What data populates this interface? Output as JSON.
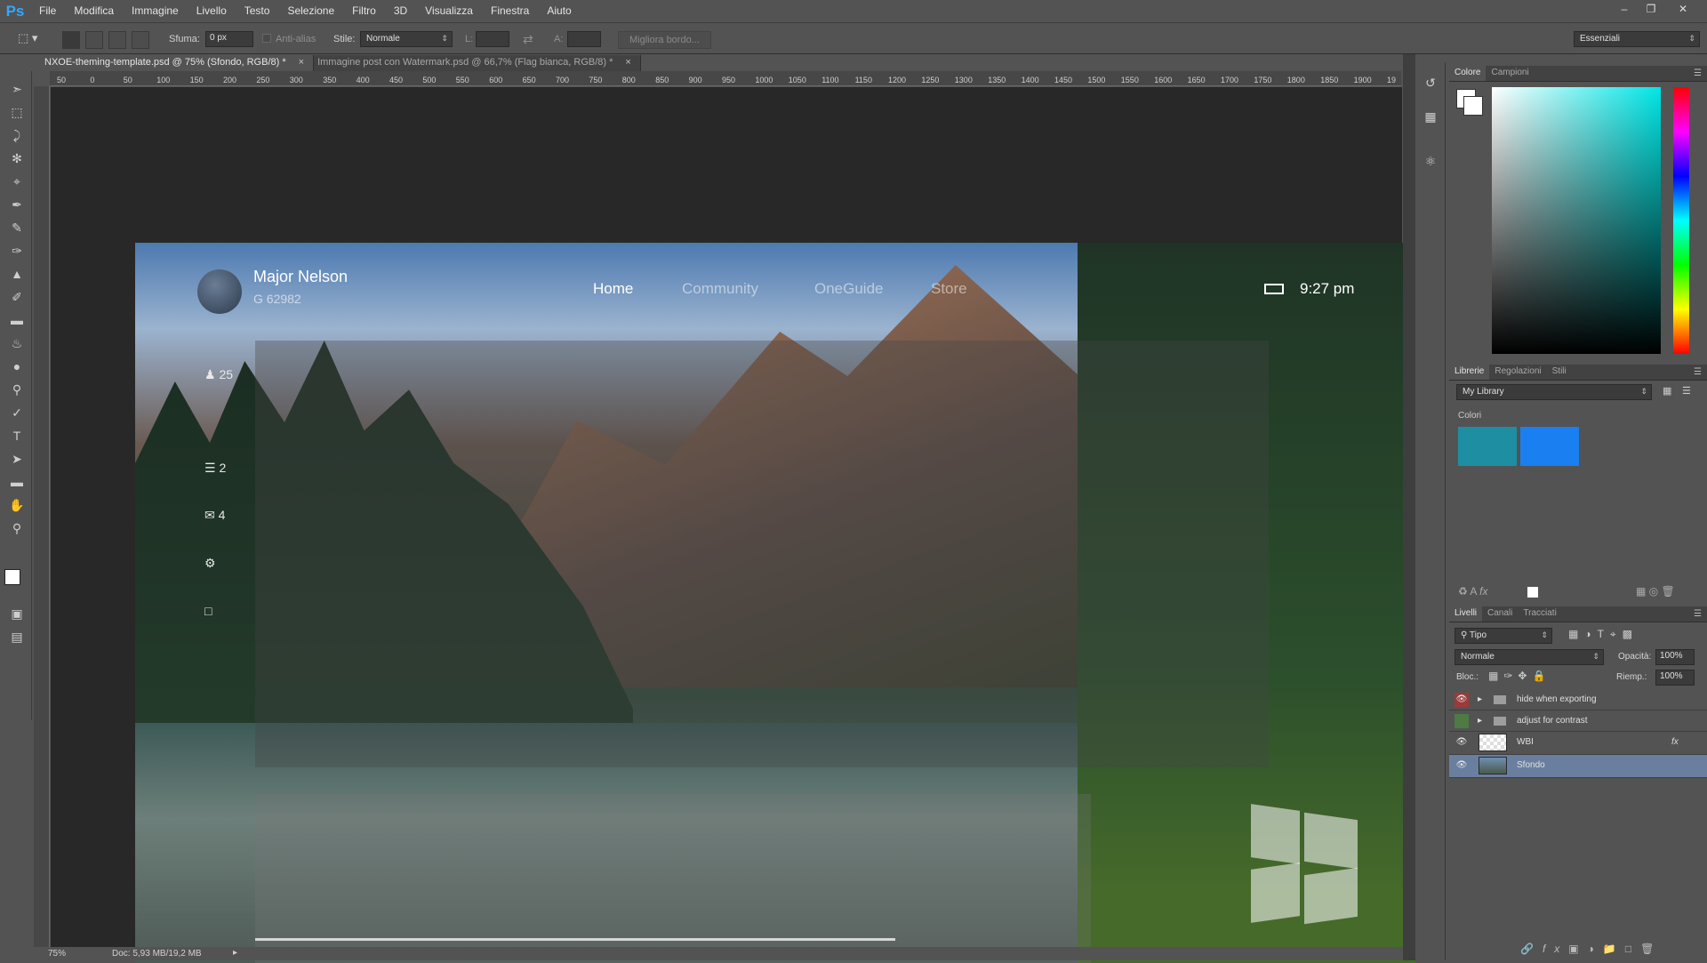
{
  "menu": {
    "logo": "Ps",
    "items": [
      "File",
      "Modifica",
      "Immagine",
      "Livello",
      "Testo",
      "Selezione",
      "Filtro",
      "3D",
      "Visualizza",
      "Finestra",
      "Aiuto"
    ]
  },
  "options": {
    "feather_label": "Sfuma:",
    "feather_value": "0 px",
    "antialias_label": "Anti-alias",
    "style_label": "Stile:",
    "style_value": "Normale",
    "width_label": "L:",
    "height_label": "A:",
    "refine_button": "Migliora bordo...",
    "workspace": "Essenziali"
  },
  "tabs": [
    {
      "label": "NXOE-theming-template.psd @ 75% (Sfondo, RGB/8) *",
      "close": "×"
    },
    {
      "label": "Immagine post con Watermark.psd @ 66,7% (Flag bianca, RGB/8) *",
      "close": "×"
    }
  ],
  "ruler_ticks": [
    "50",
    "0",
    "50",
    "100",
    "150",
    "200",
    "250",
    "300",
    "350",
    "400",
    "450",
    "500",
    "550",
    "600",
    "650",
    "700",
    "750",
    "800",
    "850",
    "900",
    "950",
    "1000",
    "1050",
    "1100",
    "1150",
    "1200",
    "1250",
    "1300",
    "1350",
    "1400",
    "1450",
    "1500",
    "1550",
    "1600",
    "1650",
    "1700",
    "1750",
    "1800",
    "1850",
    "1900",
    "19"
  ],
  "artwork": {
    "user_name": "Major Nelson",
    "gamerscore": "G 62982",
    "nav": [
      "Home",
      "Community",
      "OneGuide",
      "Store"
    ],
    "time": "9:27 pm",
    "side_items": [
      "25",
      "2",
      "4"
    ]
  },
  "status": {
    "zoom": "75%",
    "doc": "Doc: 5,93 MB/19,2 MB"
  },
  "color_panel": {
    "tabs": [
      "Colore",
      "Campioni"
    ]
  },
  "library_panel": {
    "tabs": [
      "Librerie",
      "Regolazioni",
      "Stili"
    ],
    "library_name": "My Library",
    "section": "Colori",
    "swatches": [
      "#1e8ea3",
      "#1a7ff0"
    ]
  },
  "layers_panel": {
    "tabs": [
      "Livelli",
      "Canali",
      "Tracciati"
    ],
    "filter": "Tipo",
    "blend": "Normale",
    "opacity_label": "Opacità:",
    "opacity": "100%",
    "lock_label": "Bloc.:",
    "fill_label": "Riemp.:",
    "fill": "100%",
    "layers": [
      {
        "name": "hide when exporting",
        "type": "group",
        "eye": "red"
      },
      {
        "name": "adjust for contrast",
        "type": "group",
        "eye": "green"
      },
      {
        "name": "WBI",
        "type": "layer",
        "fx": "fx"
      },
      {
        "name": "Sfondo",
        "type": "layer",
        "selected": true
      }
    ]
  }
}
